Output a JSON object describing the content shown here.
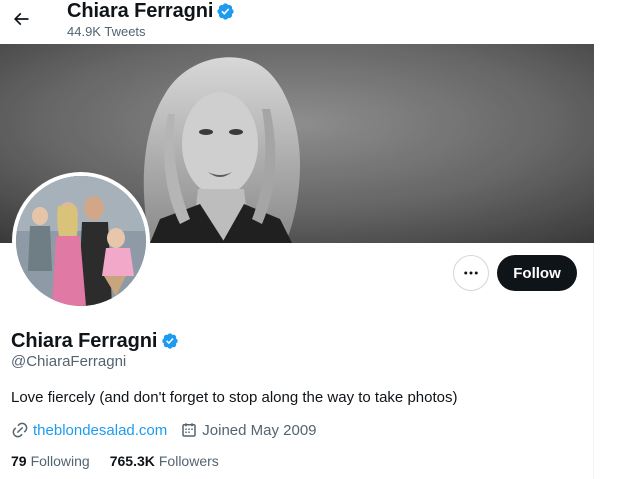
{
  "header": {
    "name": "Chiara Ferragni",
    "tweets_count": "44.9K Tweets"
  },
  "profile": {
    "name": "Chiara Ferragni",
    "handle": "@ChiaraFerragni",
    "bio": "Love fiercely (and don't forget to stop along the way to take photos)",
    "website": "theblondesalad.com",
    "joined": "Joined May 2009",
    "following_count": "79",
    "following_label": "Following",
    "followers_count": "765.3K",
    "followers_label": "Followers"
  },
  "actions": {
    "follow_label": "Follow"
  },
  "icons": {
    "back": "arrow-left-icon",
    "verified": "verified-badge-icon",
    "more": "more-horizontal-icon",
    "link": "link-icon",
    "calendar": "calendar-icon"
  },
  "colors": {
    "accent": "#1d9bf0",
    "follow_button": "#0f1419",
    "secondary_text": "#536471"
  }
}
